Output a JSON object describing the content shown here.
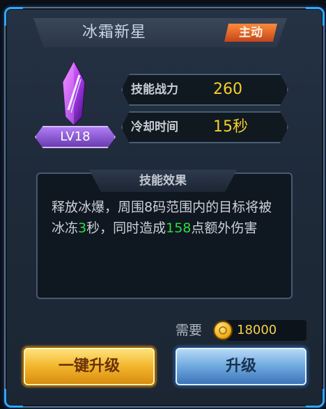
{
  "skill": {
    "name": "冰霜新星",
    "type_badge": "主动",
    "level_badge": "LV18"
  },
  "stats": [
    {
      "label": "技能战力",
      "value": "260"
    },
    {
      "label": "冷却时间",
      "value": "15秒"
    }
  ],
  "effect": {
    "title": "技能效果",
    "part1": "释放冰爆，周围8码范围内的目标将被冰冻",
    "freeze_seconds": "3",
    "part2": "秒，同时造成",
    "damage": "158",
    "part3": "点额外伤害"
  },
  "cost": {
    "label": "需要",
    "amount": "18000",
    "currency_icon": "gold-coin-icon"
  },
  "buttons": {
    "one_click_upgrade": "一键升级",
    "upgrade": "升级"
  },
  "colors": {
    "accent_blue": "#2fa7ff",
    "stat_value": "#f5d028",
    "highlight_green": "#2ddb45",
    "badge_orange": "#e2642a",
    "level_purple": "#8b5bd0"
  }
}
